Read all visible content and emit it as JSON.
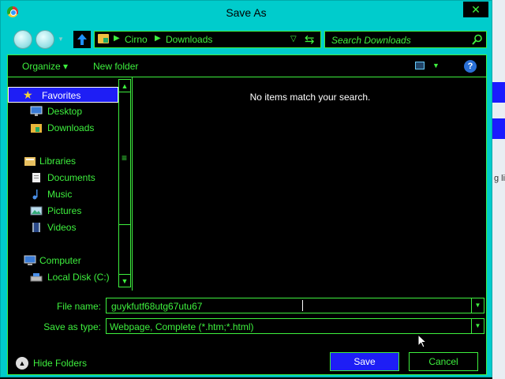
{
  "window": {
    "title": "Save As",
    "close_glyph": "✕"
  },
  "nav": {
    "up_glyph": "🡅",
    "address_crumbs": [
      "Cirno",
      "Downloads"
    ],
    "search_placeholder": "Search Downloads"
  },
  "toolbar": {
    "organize_label": "Organize ▾",
    "new_folder_label": "New folder",
    "help_glyph": "?"
  },
  "sidebar": {
    "items": [
      {
        "label": "Favorites",
        "icon": "star-icon",
        "selected": true
      },
      {
        "label": "Desktop",
        "icon": "desktop-icon"
      },
      {
        "label": "Downloads",
        "icon": "downloads-folder-icon"
      },
      {
        "label": "Libraries",
        "icon": "libraries-icon"
      },
      {
        "label": "Documents",
        "icon": "documents-icon"
      },
      {
        "label": "Music",
        "icon": "music-icon"
      },
      {
        "label": "Pictures",
        "icon": "pictures-icon"
      },
      {
        "label": "Videos",
        "icon": "videos-icon"
      },
      {
        "label": "Computer",
        "icon": "computer-icon"
      },
      {
        "label": "Local Disk (C:)",
        "icon": "disk-icon"
      }
    ]
  },
  "content": {
    "empty_message": "No items match your search."
  },
  "form": {
    "file_name_label": "File name:",
    "file_name_value": "guykfutf68utg67utu67",
    "save_type_label": "Save as type:",
    "save_type_value": "Webpage, Complete (*.htm;*.html)"
  },
  "footer": {
    "hide_folders_label": "Hide Folders",
    "save_label": "Save",
    "cancel_label": "Cancel"
  },
  "colors": {
    "accent_green": "#3ef03e",
    "frame_cyan": "#00cccc",
    "selection_blue": "#1e1ef5"
  }
}
